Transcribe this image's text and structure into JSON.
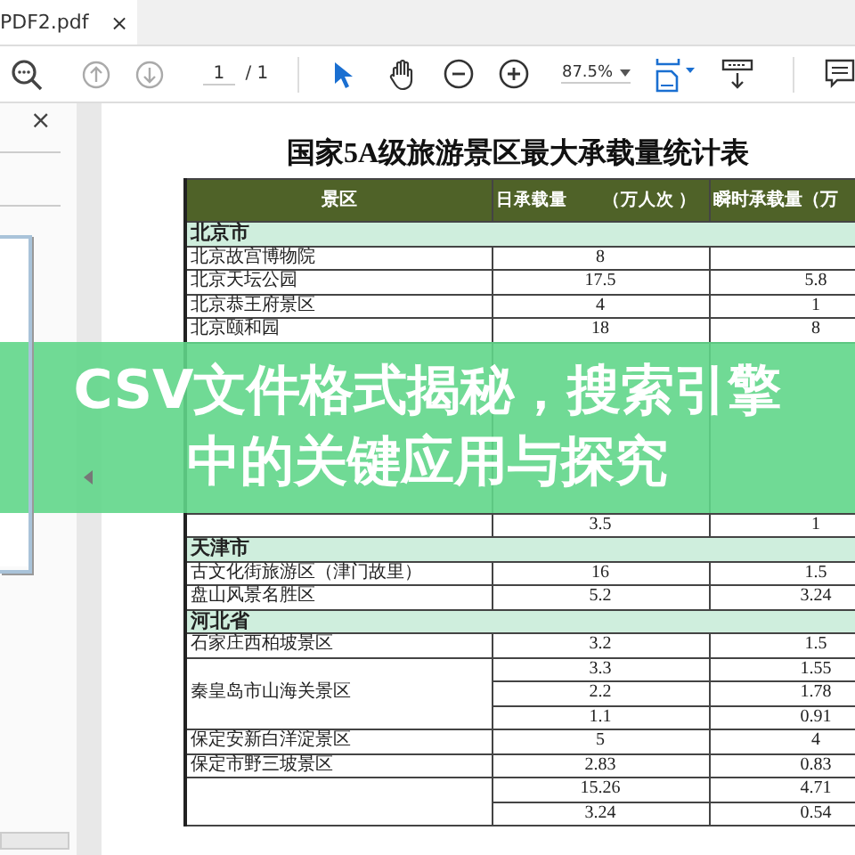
{
  "tab": {
    "title": "PDF2.pdf",
    "close": "×"
  },
  "toolbar": {
    "page": "1",
    "page_total": "/ 1",
    "zoom": "87.5%"
  },
  "side_panel": {
    "close": "×"
  },
  "document": {
    "title": "国家5A级旅游景区最大承载量统计表",
    "columns": [
      "景区",
      "日承载量　　（万人次 ）",
      "瞬时承载量（万"
    ],
    "sections": [
      {
        "name": "北京市",
        "groups": [
          {
            "name": "北京故宫博物院",
            "values": [
              {
                "daily": "8"
              }
            ]
          },
          {
            "name": "北京天坛公园",
            "values": [
              {
                "daily": "17.5",
                "instant": "5.8"
              }
            ]
          },
          {
            "name": "北京恭王府景区",
            "values": [
              {
                "daily": "4",
                "instant": "1"
              }
            ]
          },
          {
            "name": "北京颐和园",
            "values": [
              {
                "daily": "18",
                "instant": "8"
              }
            ]
          },
          {
            "kind": "covered"
          },
          {
            "values": [
              {
                "daily": "3.5",
                "instant": "1"
              }
            ]
          }
        ]
      },
      {
        "name": "天津市",
        "groups": [
          {
            "name": "古文化街旅游区（津门故里）",
            "values": [
              {
                "daily": "16",
                "instant": "1.5"
              }
            ]
          },
          {
            "name": "盘山风景名胜区",
            "values": [
              {
                "daily": "5.2",
                "instant": "3.24"
              }
            ]
          }
        ]
      },
      {
        "name": "河北省",
        "groups": [
          {
            "name": "石家庄西柏坡景区",
            "values": [
              {
                "daily": "3.2",
                "instant": "1.5"
              }
            ]
          },
          {
            "name": "秦皇岛市山海关景区",
            "values": [
              {
                "daily": "3.3",
                "instant": "1.55"
              },
              {
                "daily": "2.2",
                "instant": "1.78"
              },
              {
                "daily": "1.1",
                "instant": "0.91"
              }
            ]
          },
          {
            "name": "保定安新白洋淀景区",
            "values": [
              {
                "daily": "5",
                "instant": "4"
              }
            ]
          },
          {
            "name": "保定市野三坡景区",
            "values": [
              {
                "daily": "2.83",
                "instant": "0.83"
              }
            ]
          },
          {
            "values": [
              {
                "daily": "15.26",
                "instant": "4.71"
              },
              {
                "daily": "3.24",
                "instant": "0.54"
              }
            ]
          }
        ]
      }
    ]
  },
  "banner": {
    "lines": [
      "CSV文件格式揭秘，搜索引擎",
      "中的关键应用与探究"
    ]
  }
}
